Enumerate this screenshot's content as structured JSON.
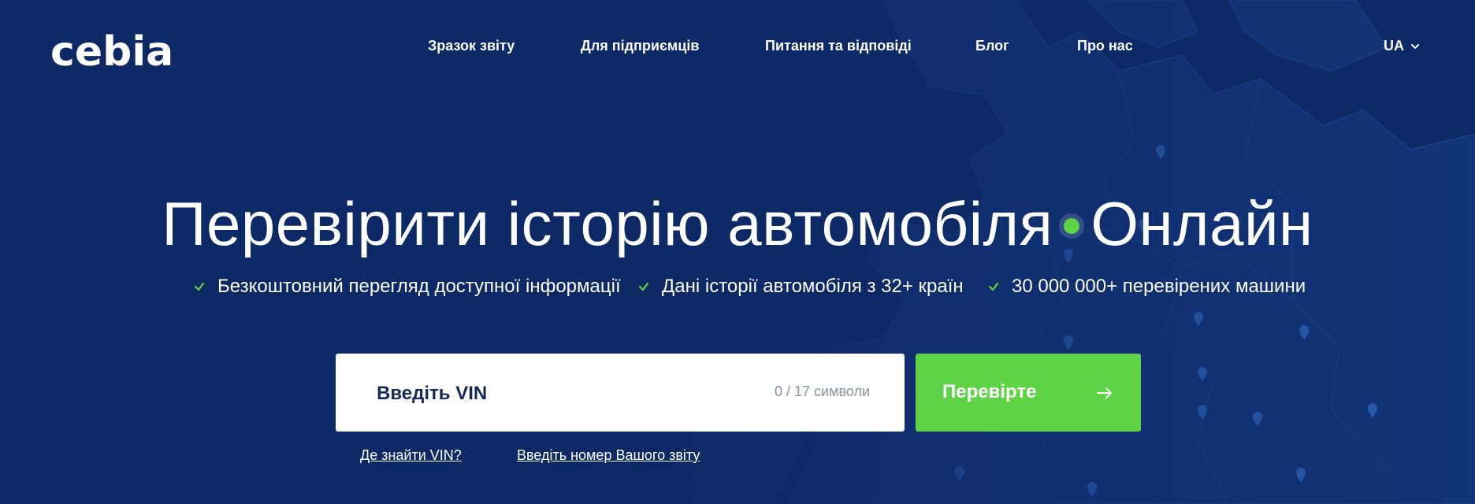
{
  "brand": {
    "logo": "cebia",
    "colors": {
      "background": "#0e2a66",
      "accent": "#5ed345",
      "text": "#ffffff",
      "input_text": "#152a5a"
    }
  },
  "nav": {
    "items": [
      {
        "label": "Зразок звіту"
      },
      {
        "label": "Для підприємців"
      },
      {
        "label": "Питання та відповіді"
      },
      {
        "label": "Блог"
      },
      {
        "label": "Про нас"
      }
    ]
  },
  "language": {
    "current": "UA",
    "icon": "chevron-down-icon"
  },
  "hero": {
    "title_main": "Перевірити історію автомобіля",
    "title_highlight": "Онлайн",
    "features": [
      {
        "icon": "check-icon",
        "text": "Безкоштовний перегляд доступної інформації"
      },
      {
        "icon": "check-icon",
        "text": "Дані історії автомобіля з 32+ країн"
      },
      {
        "icon": "check-icon",
        "text": "30 000 000+ перевірених машини"
      }
    ]
  },
  "search": {
    "placeholder": "Введіть VIN",
    "value": "",
    "counter": "0 / 17 символи",
    "button_label": "Перевірте",
    "button_icon": "arrow-right-icon"
  },
  "links": {
    "where_vin": "Де знайти VIN?",
    "report_number": "Введіть номер Вашого звіту"
  }
}
